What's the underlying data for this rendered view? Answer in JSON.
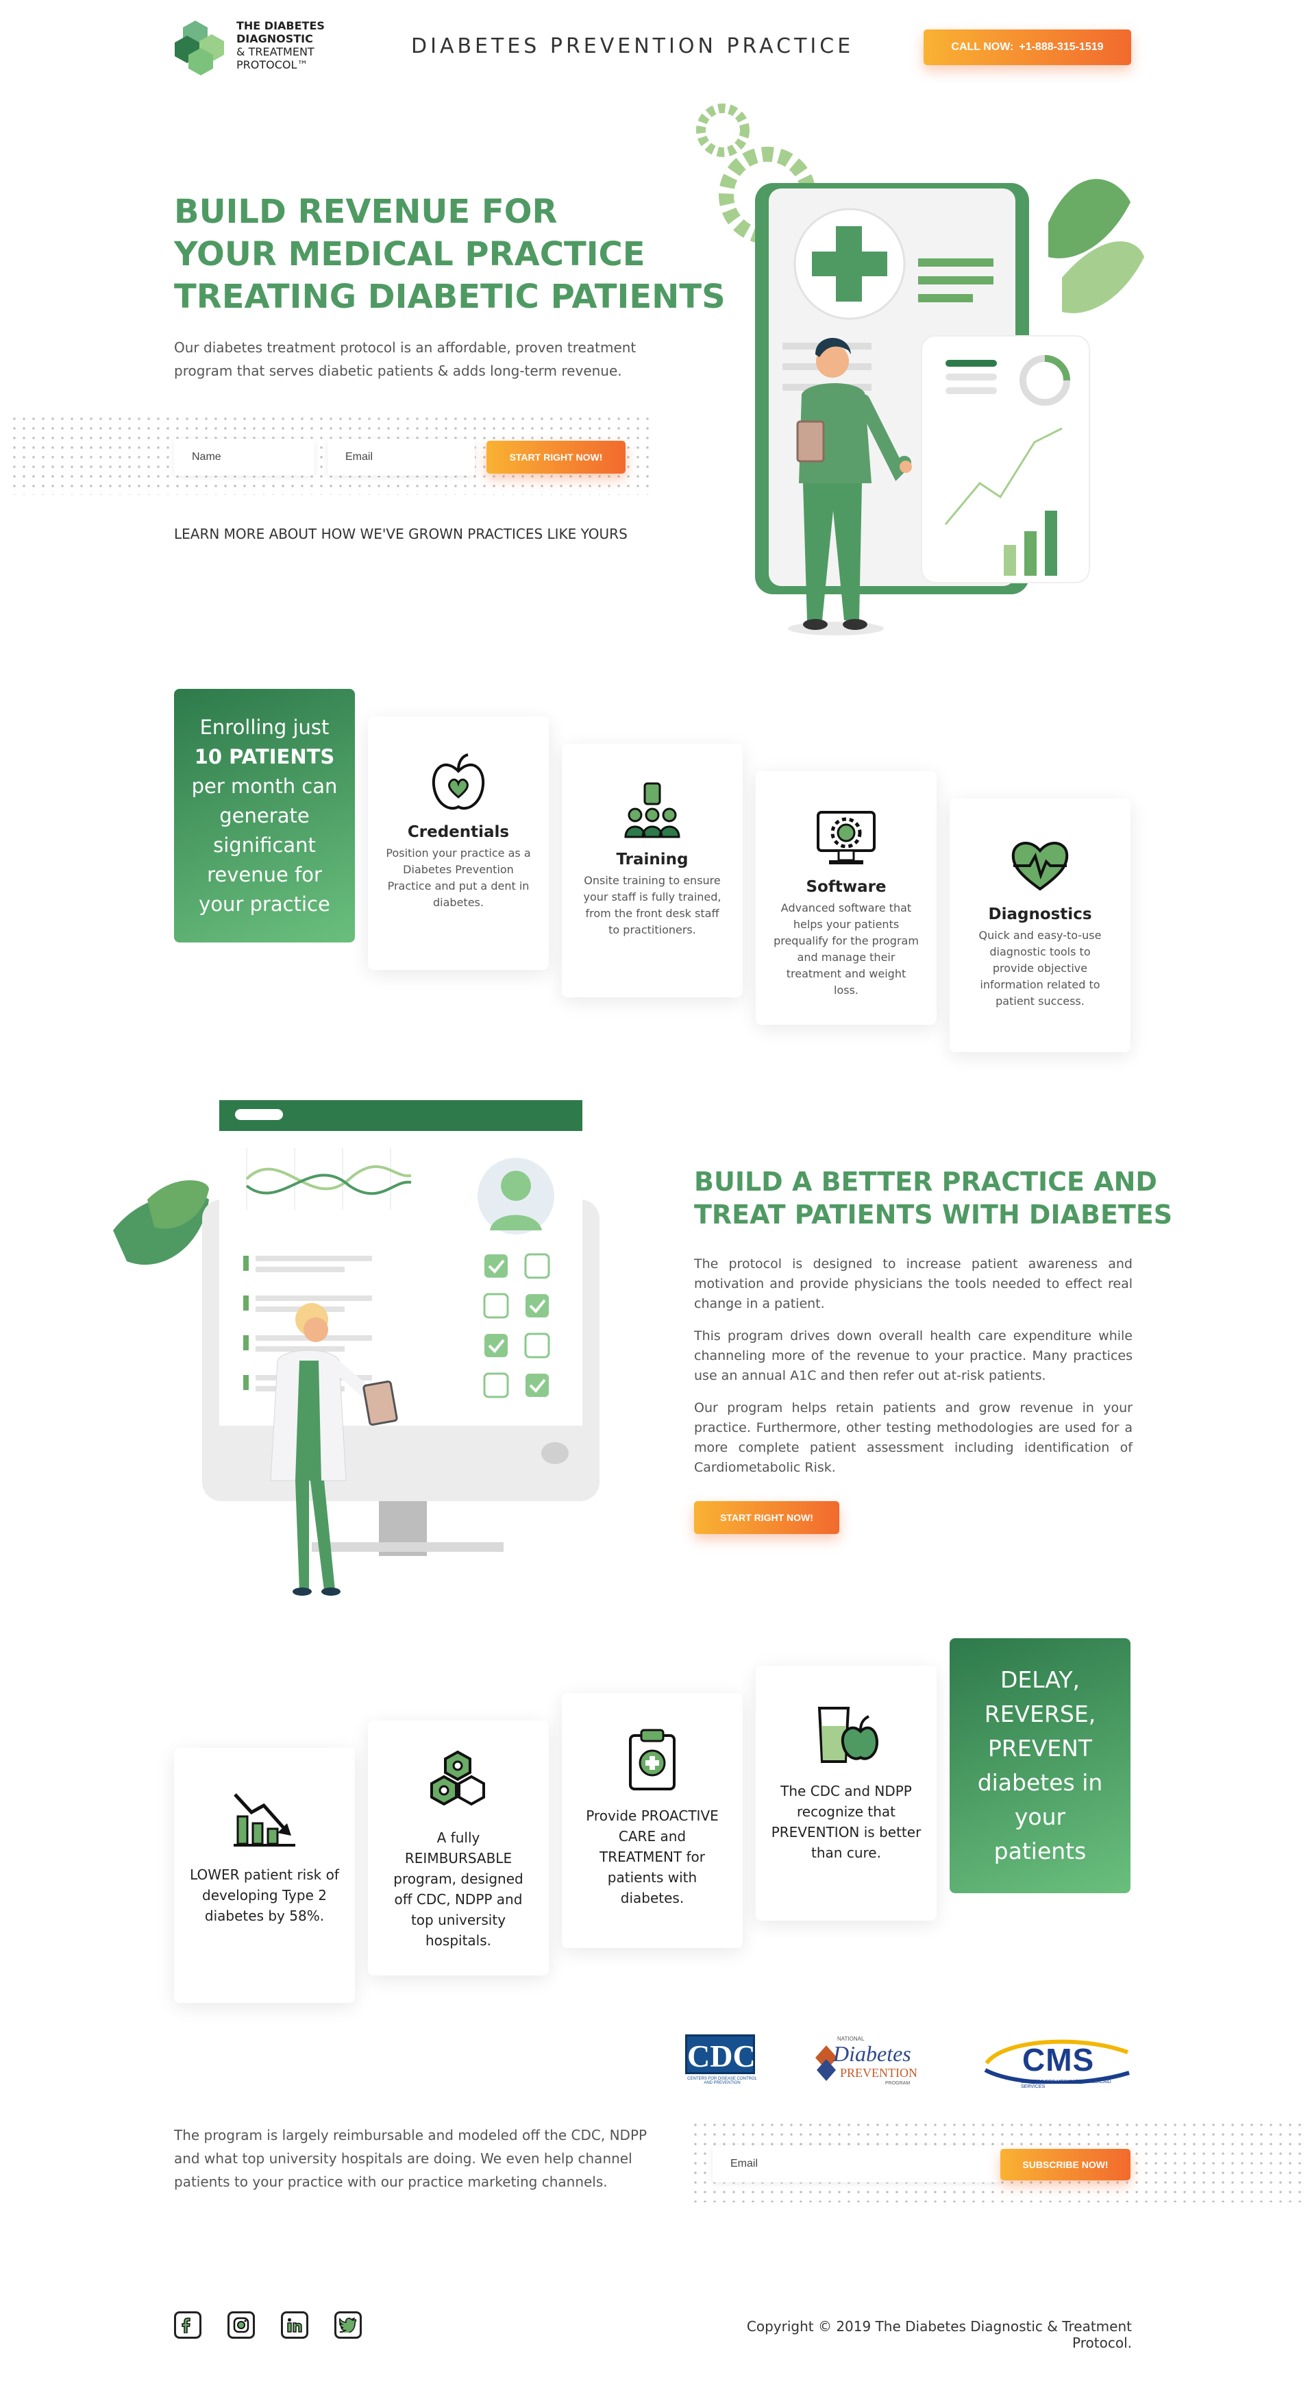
{
  "header": {
    "logo_line1": "THE DIABETES",
    "logo_line2": "DIAGNOSTIC",
    "logo_line3": "& TREATMENT",
    "logo_line4": "PROTOCOL™",
    "site_title": "DIABETES PREVENTION PRACTICE",
    "call_label": "CALL NOW:",
    "phone": "+1-888-315-1519"
  },
  "hero": {
    "title_line1": "BUILD REVENUE FOR",
    "title_line2": "YOUR MEDICAL PRACTICE",
    "title_line3": "TREATING DIABETIC PATIENTS",
    "paragraph": "Our diabetes treatment protocol is an affordable, proven treatment program that serves diabetic patients & adds long-term revenue.",
    "name_placeholder": "Name",
    "email_placeholder": "Email",
    "cta": "START RIGHT NOW!",
    "learn_more": "LEARN MORE ABOUT HOW WE'VE GROWN PRACTICES LIKE YOURS"
  },
  "features": {
    "green_box": {
      "line1": "Enrolling just",
      "line2": "10 PATIENTS",
      "line3": "per month can generate significant revenue for your practice"
    },
    "cards": [
      {
        "title": "Credentials",
        "text": "Position your practice as a Diabetes Prevention Practice and put a dent in diabetes.",
        "icon": "apple-heart-icon"
      },
      {
        "title": "Training",
        "text": "Onsite training to ensure your staff is fully trained, from the front desk staff to practitioners.",
        "icon": "team-training-icon"
      },
      {
        "title": "Software",
        "text": "Advanced software that helps your patients prequalify for the program and manage their treatment and weight loss.",
        "icon": "monitor-gear-icon"
      },
      {
        "title": "Diagnostics",
        "text": "Quick and easy-to-use diagnostic tools to provide objective information related to patient success.",
        "icon": "heart-pulse-icon"
      }
    ]
  },
  "practice": {
    "title_line1": "BUILD A BETTER PRACTICE AND",
    "title_line2": "TREAT PATIENTS WITH DIABETES",
    "p1": "The protocol is designed to increase patient awareness and motivation and provide physicians the tools needed to effect real change in a patient.",
    "p2": "This program drives down overall health care expenditure while channeling more of the revenue to your practice. Many practices use an annual A1C and then refer out at-risk patients.",
    "p3": "Our program helps retain patients and grow revenue in your practice. Furthermore, other testing methodologies are used for a more complete patient assessment including identification of Cardiometabolic Risk.",
    "cta": "START RIGHT NOW!"
  },
  "benefits": {
    "cards": [
      {
        "text": "LOWER patient risk of developing Type 2 diabetes by 58%.",
        "icon": "chart-down-icon"
      },
      {
        "text": "A fully REIMBURSABLE program, designed off CDC, NDPP and top university hospitals.",
        "icon": "hexagon-molecule-icon"
      },
      {
        "text": "Provide PROACTIVE CARE and TREATMENT for patients with diabetes.",
        "icon": "clipboard-medical-icon"
      },
      {
        "text": "The CDC and NDPP recognize that PREVENTION is better than cure.",
        "icon": "apple-juice-icon"
      }
    ],
    "green_box": "DELAY, REVERSE, PREVENT diabetes in your patients"
  },
  "logos": {
    "cdc": "CDC",
    "cdc_sub": "CENTERS FOR DISEASE CONTROL AND PREVENTION",
    "ndpp_small": "NATIONAL",
    "ndpp_big": "Diabetes",
    "ndpp_mid": "PREVENTION",
    "ndpp_sub": "PROGRAM",
    "cms": "CMS",
    "cms_sub": "CENTERS FOR MEDICARE & MEDICAID SERVICES"
  },
  "subscribe": {
    "text": "The program is largely reimbursable and modeled off the CDC, NDPP and what top university hospitals are doing. We even help channel patients to your practice with our practice marketing channels.",
    "email_placeholder": "Email",
    "cta": "SUBSCRIBE NOW!"
  },
  "footer": {
    "copyright": "Copyright © 2019 The Diabetes Diagnostic & Treatment Protocol.",
    "social": [
      "facebook-icon",
      "instagram-icon",
      "linkedin-icon",
      "twitter-icon"
    ]
  },
  "colors": {
    "green_dark": "#2e7a4b",
    "green_mid": "#4f9a63",
    "green_light": "#8cc98d",
    "orange_start": "#f9b233",
    "orange_end": "#f26a2e"
  }
}
